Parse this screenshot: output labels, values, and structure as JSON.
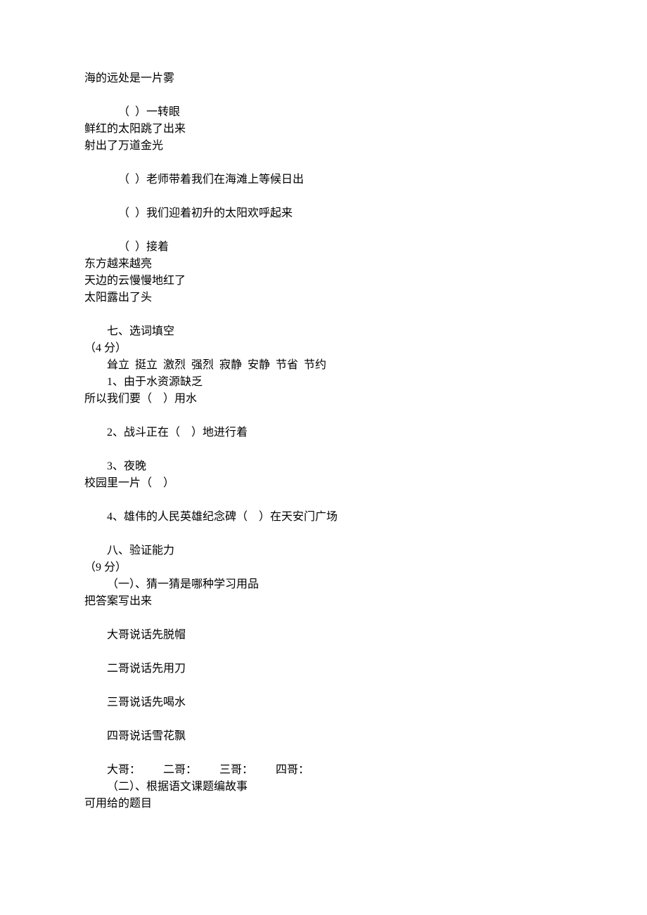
{
  "lines": [
    {
      "text": "海的远处是一片雾",
      "indent": 0
    },
    {
      "text": "",
      "blank": true
    },
    {
      "text": "（  ）一转眼",
      "indent": 2
    },
    {
      "text": "鲜红的太阳跳了出来",
      "indent": 0
    },
    {
      "text": "射出了万道金光",
      "indent": 0
    },
    {
      "text": "",
      "blank": true
    },
    {
      "text": "（  ）老师带着我们在海滩上等候日出",
      "indent": 2
    },
    {
      "text": "",
      "blank": true
    },
    {
      "text": "（  ）我们迎着初升的太阳欢呼起来",
      "indent": 2
    },
    {
      "text": "",
      "blank": true
    },
    {
      "text": "（  ）接着",
      "indent": 2
    },
    {
      "text": "东方越来越亮",
      "indent": 0
    },
    {
      "text": "天边的云慢慢地红了",
      "indent": 0
    },
    {
      "text": "太阳露出了头",
      "indent": 0
    },
    {
      "text": "",
      "blank": true
    },
    {
      "text": "七、选词填空",
      "indent": 1
    },
    {
      "text": "（4 分）",
      "indent": 0
    },
    {
      "text": "耸立  挺立  激烈  强烈  寂静  安静  节省  节约",
      "indent": 1
    },
    {
      "text": "1、由于水资源缺乏",
      "indent": 1
    },
    {
      "text": "所以我们要（    ）用水",
      "indent": 0
    },
    {
      "text": "",
      "blank": true
    },
    {
      "text": "2、战斗正在（    ）地进行着",
      "indent": 1
    },
    {
      "text": "",
      "blank": true
    },
    {
      "text": "3、夜晚",
      "indent": 1
    },
    {
      "text": "校园里一片（    ）",
      "indent": 0
    },
    {
      "text": "",
      "blank": true
    },
    {
      "text": "4、雄伟的人民英雄纪念碑（    ）在天安门广场",
      "indent": 1
    },
    {
      "text": "",
      "blank": true
    },
    {
      "text": "八、验证能力",
      "indent": 1
    },
    {
      "text": "（9 分）",
      "indent": 0
    },
    {
      "text": "（一）、猜一猜是哪种学习用品",
      "indent": 1
    },
    {
      "text": "把答案写出来",
      "indent": 0
    },
    {
      "text": "",
      "blank": true
    },
    {
      "text": "大哥说话先脱帽",
      "indent": 1
    },
    {
      "text": "",
      "blank": true
    },
    {
      "text": "二哥说话先用刀",
      "indent": 1
    },
    {
      "text": "",
      "blank": true
    },
    {
      "text": "三哥说话先喝水",
      "indent": 1
    },
    {
      "text": "",
      "blank": true
    },
    {
      "text": "四哥说话雪花飘",
      "indent": 1
    },
    {
      "text": "",
      "blank": true
    },
    {
      "text": "大哥：        二哥：        三哥：        四哥：",
      "indent": 1
    },
    {
      "text": "（二）、根据语文课题编故事",
      "indent": 1
    },
    {
      "text": "可用给的题目",
      "indent": 0
    }
  ]
}
